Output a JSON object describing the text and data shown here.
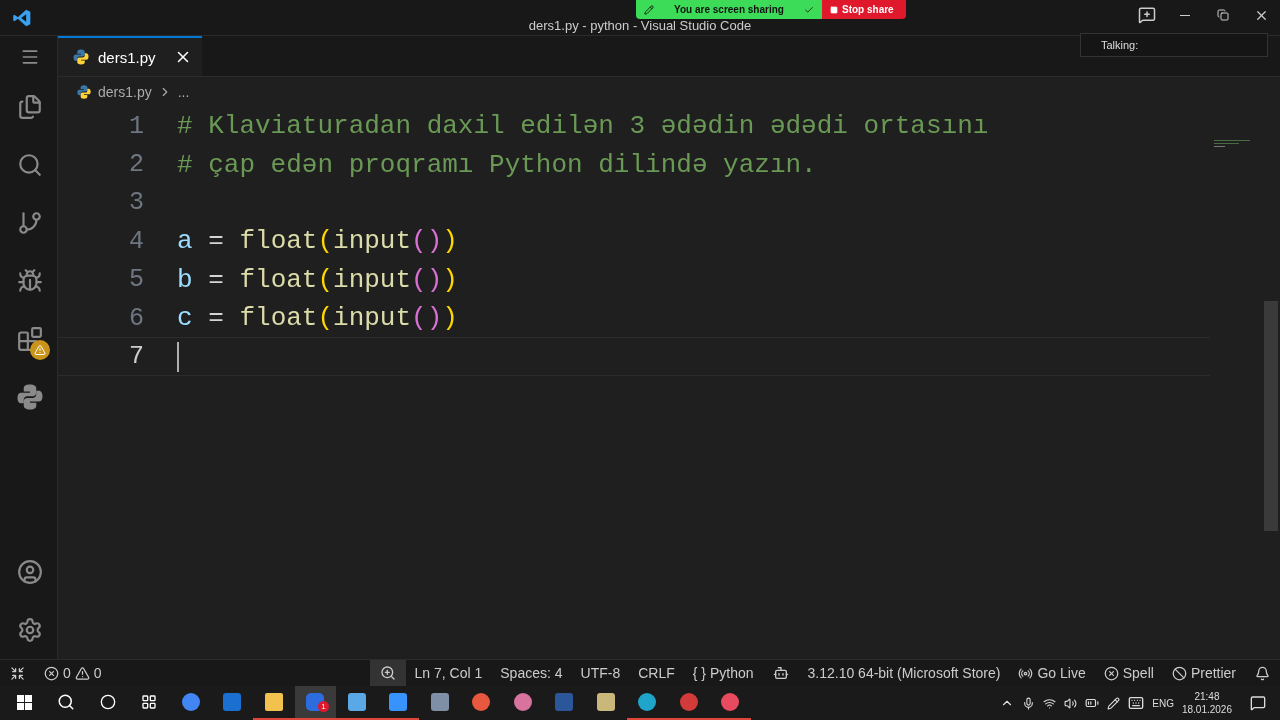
{
  "window": {
    "title": "ders1.py - python - Visual Studio Code"
  },
  "sharing": {
    "status": "You are screen sharing",
    "stop": "Stop share"
  },
  "talking": {
    "label": "Talking:"
  },
  "activity_bar": {
    "items": [
      {
        "kind": "explorer",
        "selected": false
      },
      {
        "kind": "search",
        "selected": false
      },
      {
        "kind": "scm",
        "selected": false
      },
      {
        "kind": "debug",
        "selected": false
      },
      {
        "kind": "extensions",
        "selected": false,
        "warning": true
      },
      {
        "kind": "python",
        "selected": false
      }
    ]
  },
  "tabs": [
    {
      "label": "ders1.py",
      "selected": true
    }
  ],
  "breadcrumb": {
    "file": "ders1.py",
    "more": "..."
  },
  "editor": {
    "lines": [
      {
        "number": "1",
        "current": false,
        "tokens": [
          {
            "kind": "comment",
            "text": "# Klaviaturadan daxil edilən 3 ədədin ədədi ortasını"
          }
        ]
      },
      {
        "number": "2",
        "current": false,
        "tokens": [
          {
            "kind": "comment",
            "text": "# çap edən proqramı Python dilində yazın."
          }
        ]
      },
      {
        "number": "3",
        "current": false
      },
      {
        "number": "4",
        "current": false,
        "tokens": [
          {
            "kind": "var",
            "text": "a"
          },
          {
            "kind": "op",
            "text": " = "
          },
          {
            "kind": "func",
            "text": "float"
          },
          {
            "kind": "paren1",
            "text": "("
          },
          {
            "kind": "func",
            "text": "input"
          },
          {
            "kind": "paren2",
            "text": "()"
          },
          {
            "kind": "paren1",
            "text": ")"
          }
        ]
      },
      {
        "number": "5",
        "current": false,
        "tokens": [
          {
            "kind": "var",
            "text": "b"
          },
          {
            "kind": "op",
            "text": " = "
          },
          {
            "kind": "func",
            "text": "float"
          },
          {
            "kind": "paren1",
            "text": "("
          },
          {
            "kind": "func",
            "text": "input"
          },
          {
            "kind": "paren2",
            "text": "()"
          },
          {
            "kind": "paren1",
            "text": ")"
          }
        ]
      },
      {
        "number": "6",
        "current": false,
        "tokens": [
          {
            "kind": "var",
            "text": "c"
          },
          {
            "kind": "op",
            "text": " = "
          },
          {
            "kind": "func",
            "text": "float"
          },
          {
            "kind": "paren1",
            "text": "("
          },
          {
            "kind": "func",
            "text": "input"
          },
          {
            "kind": "paren2",
            "text": "()"
          },
          {
            "kind": "paren1",
            "text": ")"
          }
        ]
      },
      {
        "number": "7",
        "current": true
      }
    ]
  },
  "status_bar": {
    "errors": "0",
    "warnings": "0",
    "position": "Ln 7, Col 1",
    "spaces": "Spaces: 4",
    "encoding": "UTF-8",
    "eol": "CRLF",
    "braces": "{ }",
    "language": "Python",
    "interpreter": "3.12.10 64-bit (Microsoft Store)",
    "go_live": "Go Live",
    "spell": "Spell",
    "prettier": "Prettier"
  },
  "taskbar": {
    "apps": [
      {
        "running": false
      },
      {
        "running": false
      },
      {
        "running": true
      },
      {
        "running": true,
        "badge": "1"
      },
      {
        "running": true
      },
      {
        "running": true
      },
      {
        "running": false
      },
      {
        "running": false
      },
      {
        "running": false
      },
      {
        "running": false
      },
      {
        "running": false
      },
      {
        "running": true
      },
      {
        "running": true
      },
      {
        "running": true
      }
    ],
    "language": "ENG",
    "time": "21:48",
    "date": "18.01.2026"
  }
}
